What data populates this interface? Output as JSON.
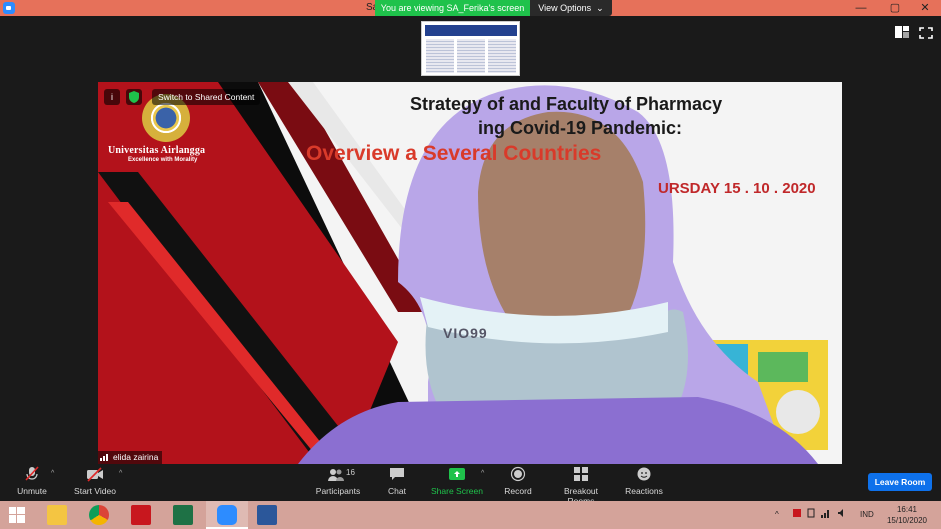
{
  "window": {
    "title": "Sa",
    "viewing_banner": "You are viewing SA_Ferika's screen",
    "view_options": "View Options",
    "minimize": "—",
    "restore": "▢",
    "close": "✕"
  },
  "video": {
    "switch_label": "Switch to Shared Content",
    "participant_name": "elida zairina",
    "slide": {
      "university": "Universitas Airlangga",
      "motto": "Excellence with Morality",
      "title_line1": "Strategy of          and Faculty of Pharmacy",
      "title_line2": "ing Covid-19 Pandemic:",
      "title_line3": "Overview a          Several Countries",
      "date": "URSDAY 15 . 10 . 2020",
      "mask_text": "VIO99"
    }
  },
  "toolbar": {
    "unmute": "Unmute",
    "start_video": "Start Video",
    "participants": "Participants",
    "participants_count": "16",
    "chat": "Chat",
    "share_screen": "Share Screen",
    "record": "Record",
    "breakout_rooms": "Breakout Rooms",
    "reactions": "Reactions",
    "leave_room": "Leave Room"
  },
  "taskbar": {
    "language": "IND",
    "time": "16:41",
    "date": "15/10/2020"
  },
  "colors": {
    "titlebar": "#e6715a",
    "banner_green": "#1fc24b",
    "leave_blue": "#0e71eb",
    "share_green": "#1fc24b",
    "taskbar": "#d4a39a"
  }
}
